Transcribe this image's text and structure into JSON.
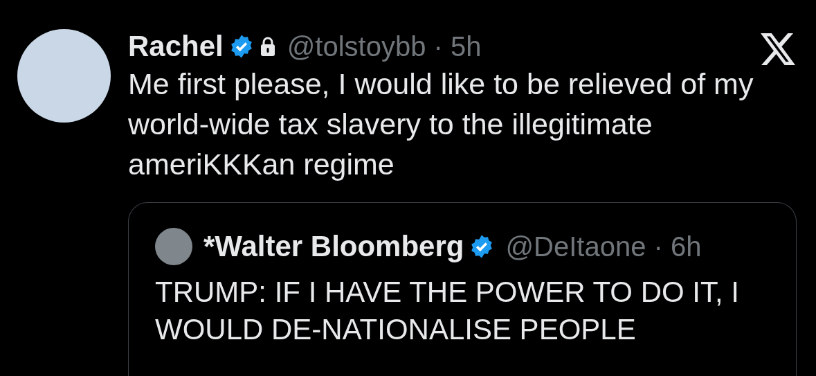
{
  "post": {
    "author": {
      "name": "Rachel",
      "verified": true,
      "protected": true,
      "meta": "@tolstoybb · 5h"
    },
    "text": "Me first please, I would like to be relieved of my world-wide tax slavery to the illegitimate ameriKKKan regime",
    "quote": {
      "author": {
        "name": "*Walter Bloomberg",
        "verified": true,
        "protected": false,
        "meta": "@DeItaone · 6h"
      },
      "text": "TRUMP: IF I HAVE THE POWER TO DO IT, I WOULD DE-NATIONALISE PEOPLE"
    }
  }
}
